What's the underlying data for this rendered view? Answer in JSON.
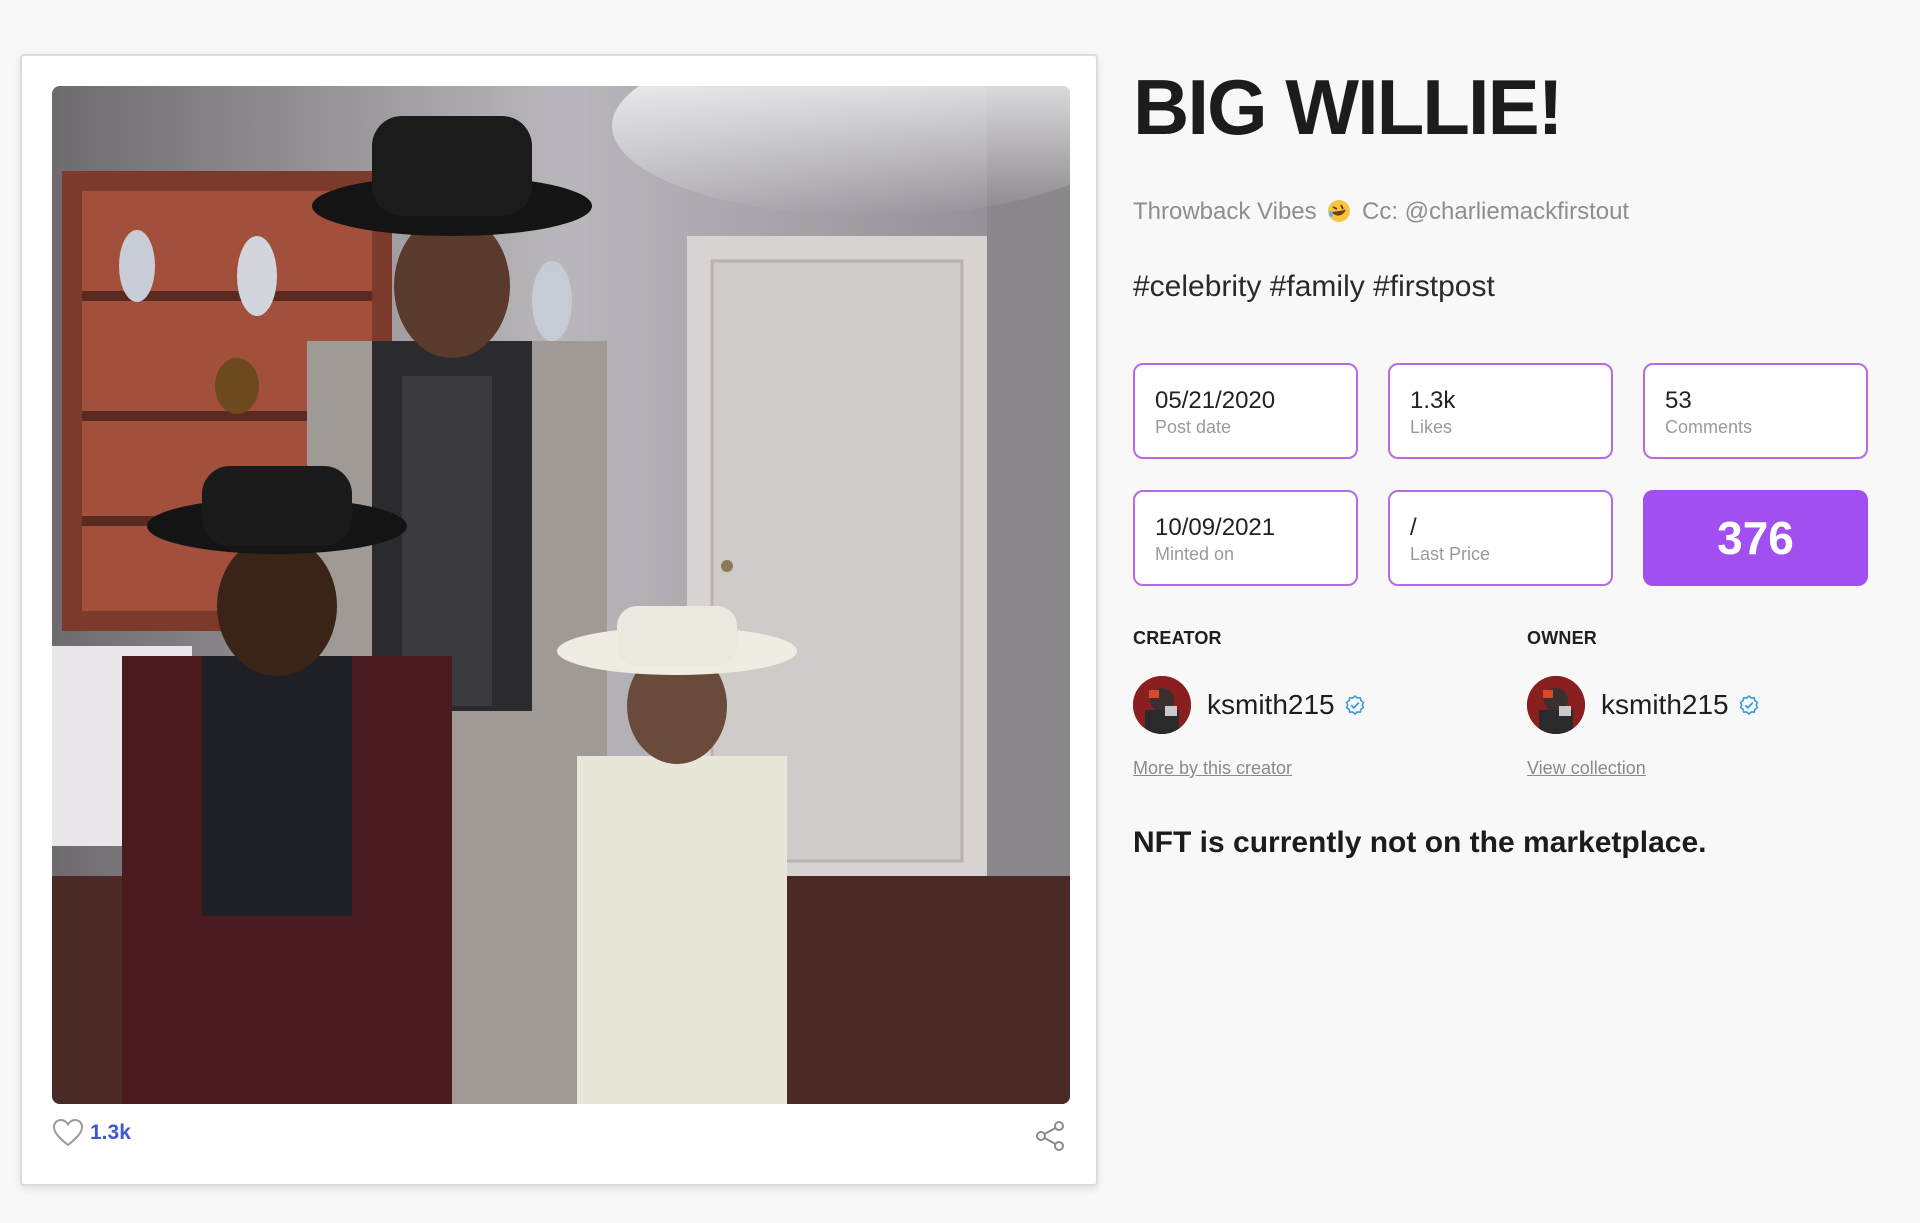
{
  "nft": {
    "title": "BIG WILLIE!",
    "description_text": "Throwback Vibes",
    "description_emoji": "rolling-on-floor-laughing-emoji",
    "description_cc": "Cc: @charliemackfirstout",
    "hashtags": "#celebrity #family #firstpost"
  },
  "card": {
    "image_alt": "photo",
    "like_count": "1.3k",
    "like_icon": "heart-outline-icon",
    "share_icon": "share-icon",
    "accent_color": "#3d57d6"
  },
  "stats": [
    {
      "value": "05/21/2020",
      "label": "Post date"
    },
    {
      "value": "1.3k",
      "label": "Likes"
    },
    {
      "value": "53",
      "label": "Comments"
    },
    {
      "value": "10/09/2021",
      "label": "Minted on"
    },
    {
      "value": "/",
      "label": "Last Price"
    }
  ],
  "score": "376",
  "score_color": "#a14ff0",
  "creator": {
    "label": "CREATOR",
    "username": "ksmith215",
    "verified": true,
    "link": "More by this creator"
  },
  "owner": {
    "label": "OWNER",
    "username": "ksmith215",
    "verified": true,
    "link": "View collection"
  },
  "status_message": "NFT is currently not on the marketplace."
}
